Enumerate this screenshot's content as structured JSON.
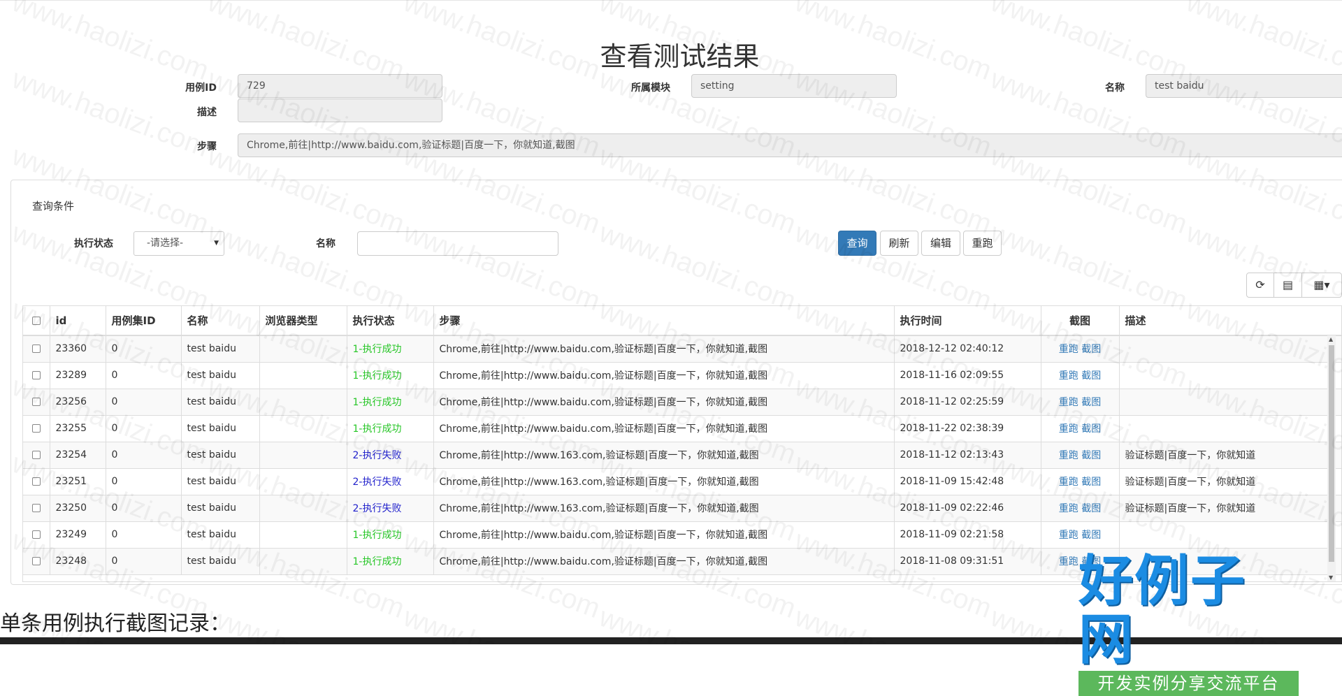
{
  "page": {
    "title": "查看测试结果"
  },
  "detail": {
    "case_id_label": "用例ID",
    "case_id_value": "729",
    "module_label": "所属模块",
    "module_value": "setting",
    "name_label": "名称",
    "name_value": "test baidu",
    "desc_label": "描述",
    "desc_value": "",
    "steps_label": "步骤",
    "steps_value": "Chrome,前往|http://www.baidu.com,验证标题|百度一下，你就知道,截图"
  },
  "query": {
    "title": "查询条件",
    "status_label": "执行状态",
    "status_selected": "-请选择-",
    "name_label": "名称",
    "name_value": "",
    "search_btn": "查询",
    "refresh_btn": "刷新",
    "edit_btn": "编辑",
    "rerun_btn": "重跑"
  },
  "table": {
    "headers": [
      "id",
      "用例集ID",
      "名称",
      "浏览器类型",
      "执行状态",
      "步骤",
      "执行时间",
      "截图",
      "描述"
    ],
    "rows": [
      {
        "id": "23360",
        "suite": "0",
        "name": "test baidu",
        "browser": "",
        "status": "1-执行成功",
        "steps": "Chrome,前往|http://www.baidu.com,验证标题|百度一下，你就知道,截图",
        "time": "2018-12-12 02:40:12",
        "rerun": "重跑",
        "shot": "截图",
        "desc": ""
      },
      {
        "id": "23289",
        "suite": "0",
        "name": "test baidu",
        "browser": "",
        "status": "1-执行成功",
        "steps": "Chrome,前往|http://www.baidu.com,验证标题|百度一下，你就知道,截图",
        "time": "2018-11-16 02:09:55",
        "rerun": "重跑",
        "shot": "截图",
        "desc": ""
      },
      {
        "id": "23256",
        "suite": "0",
        "name": "test baidu",
        "browser": "",
        "status": "1-执行成功",
        "steps": "Chrome,前往|http://www.baidu.com,验证标题|百度一下，你就知道,截图",
        "time": "2018-11-12 02:25:59",
        "rerun": "重跑",
        "shot": "截图",
        "desc": ""
      },
      {
        "id": "23255",
        "suite": "0",
        "name": "test baidu",
        "browser": "",
        "status": "1-执行成功",
        "steps": "Chrome,前往|http://www.baidu.com,验证标题|百度一下，你就知道,截图",
        "time": "2018-11-22 02:38:39",
        "rerun": "重跑",
        "shot": "截图",
        "desc": ""
      },
      {
        "id": "23254",
        "suite": "0",
        "name": "test baidu",
        "browser": "",
        "status": "2-执行失败",
        "steps": "Chrome,前往|http://www.163.com,验证标题|百度一下，你就知道,截图",
        "time": "2018-11-12 02:13:43",
        "rerun": "重跑",
        "shot": "截图",
        "desc": "验证标题|百度一下，你就知道"
      },
      {
        "id": "23251",
        "suite": "0",
        "name": "test baidu",
        "browser": "",
        "status": "2-执行失败",
        "steps": "Chrome,前往|http://www.163.com,验证标题|百度一下，你就知道,截图",
        "time": "2018-11-09 15:42:48",
        "rerun": "重跑",
        "shot": "截图",
        "desc": "验证标题|百度一下，你就知道"
      },
      {
        "id": "23250",
        "suite": "0",
        "name": "test baidu",
        "browser": "",
        "status": "2-执行失败",
        "steps": "Chrome,前往|http://www.163.com,验证标题|百度一下，你就知道,截图",
        "time": "2018-11-09 02:22:46",
        "rerun": "重跑",
        "shot": "截图",
        "desc": "验证标题|百度一下，你就知道"
      },
      {
        "id": "23249",
        "suite": "0",
        "name": "test baidu",
        "browser": "",
        "status": "1-执行成功",
        "steps": "Chrome,前往|http://www.baidu.com,验证标题|百度一下，你就知道,截图",
        "time": "2018-11-09 02:21:58",
        "rerun": "重跑",
        "shot": "截图",
        "desc": ""
      },
      {
        "id": "23248",
        "suite": "0",
        "name": "test baidu",
        "browser": "",
        "status": "1-执行成功",
        "steps": "Chrome,前往|http://www.baidu.com,验证标题|百度一下，你就知道,截图",
        "time": "2018-11-08 09:31:51",
        "rerun": "重跑",
        "shot": "截图",
        "desc": ""
      }
    ]
  },
  "footer": {
    "subheading": "单条用例执行截图记录："
  },
  "watermark": {
    "text": "www.haolizi.com",
    "logo_main": "好例子网",
    "logo_sub": "开发实例分享交流平台"
  },
  "colors": {
    "primary": "#337ab7",
    "success_text": "#27c627",
    "fail_text": "#2222cc",
    "logo_blue": "#1b8ce3",
    "logo_green": "#5cb85c"
  },
  "icons": {
    "refresh": "refresh-icon",
    "toggle": "list-toggle-icon",
    "columns": "columns-icon"
  }
}
